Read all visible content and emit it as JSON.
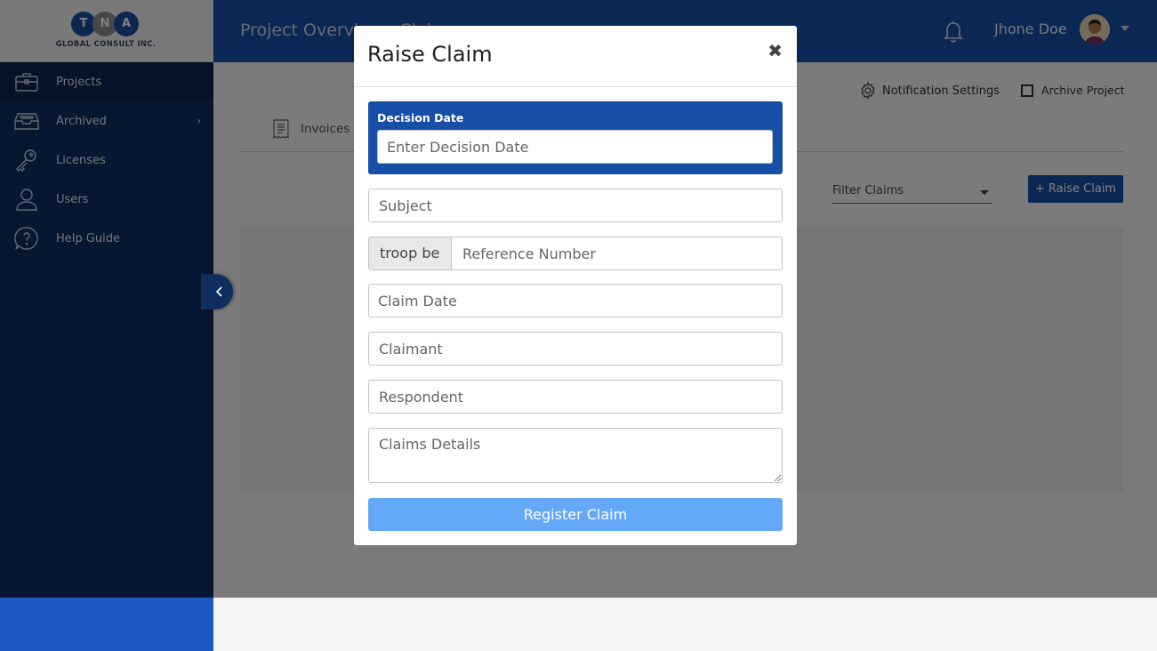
{
  "brand": {
    "logo_letters": [
      "T",
      "N",
      "A"
    ],
    "logo_colors": [
      "#1c4fa0",
      "#8e8e8e",
      "#1c4fa0"
    ],
    "company": "GLOBAL CONSULT INC."
  },
  "sidebar": {
    "items": [
      {
        "label": "Projects",
        "icon": "briefcase-icon",
        "active": true
      },
      {
        "label": "Archived",
        "icon": "archive-box-icon",
        "has_submenu": true
      },
      {
        "label": "Licenses",
        "icon": "key-icon"
      },
      {
        "label": "Users",
        "icon": "user-icon"
      },
      {
        "label": "Help Guide",
        "icon": "help-chat-icon"
      }
    ],
    "chevron": "›",
    "collapse": "‹"
  },
  "header": {
    "title": "Project Overview - Claims",
    "user_name": "Jhone Doe"
  },
  "content": {
    "notification_settings": "Notification Settings",
    "archive_project": "Archive Project",
    "tab_invoices": "Invoices",
    "filter_placeholder": "Filter Claims",
    "raise_claim_button": "+ Raise Claim"
  },
  "modal": {
    "title": "Raise Claim",
    "close": "✖",
    "decision_date_label": "Decision Date",
    "decision_date_placeholder": "Enter Decision Date",
    "subject_placeholder": "Subject",
    "reference_prefix": "troop be",
    "reference_placeholder": "Reference Number",
    "claim_date_placeholder": "Claim Date",
    "claimant_placeholder": "Claimant",
    "respondent_placeholder": "Respondent",
    "details_placeholder": "Claims Details",
    "register_button": "Register Claim"
  },
  "colors": {
    "sidebar_bg": "#102f63",
    "header_bg": "#174ea6",
    "accent_light": "#64a9f7"
  }
}
